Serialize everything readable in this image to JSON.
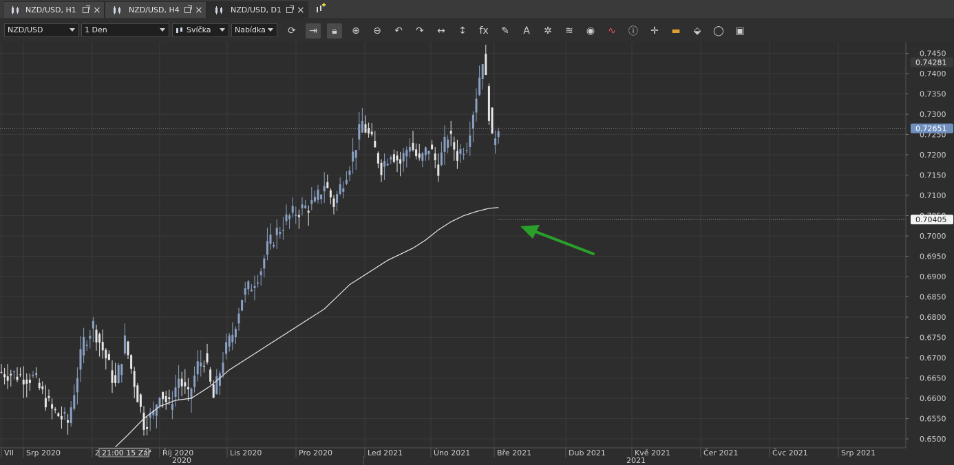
{
  "tabs": [
    {
      "label": "NZD/USD, H1"
    },
    {
      "label": "NZD/USD, H4"
    },
    {
      "label": "NZD/USD, D1"
    }
  ],
  "toolbar": {
    "symbol": "NZD/USD",
    "timeframe": "1 Den",
    "chart_type": "Svíčka",
    "price_side": "Nabídka"
  },
  "tool_icons": [
    "refresh-icon",
    "autoscroll-icon",
    "lock-icon",
    "zoom-in-icon",
    "zoom-out-icon",
    "undo-icon",
    "redo-icon",
    "horizontal-scale-icon",
    "vertical-scale-icon",
    "indicator-fx-icon",
    "pencil-icon",
    "text-tool-icon",
    "crosshair-network-icon",
    "layers-icon",
    "eye-icon",
    "oscillator-icon",
    "info-icon",
    "cursor-cross-icon",
    "color-bar-icon",
    "paint-bucket-icon",
    "circle-icon",
    "save-icon"
  ],
  "chart_data": {
    "type": "candlestick",
    "ylim": [
      0.6478,
      0.7478
    ],
    "y_ticks": [
      0.745,
      0.74,
      0.735,
      0.73,
      0.725,
      0.72,
      0.715,
      0.71,
      0.705,
      0.7,
      0.695,
      0.69,
      0.685,
      0.68,
      0.675,
      0.67,
      0.665,
      0.66,
      0.655,
      0.65
    ],
    "price_labels": {
      "high": "0.74281",
      "current": "0.72651",
      "ma": "0.70405"
    },
    "x_axis_labels": [
      "VII",
      "Srp 2020",
      "Zá",
      "Říj 2020",
      "Lis 2020",
      "Pro 2020",
      "Led 2021",
      "Úno 2021",
      "Bře 2021",
      "Dub 2021",
      "Kvě 2021",
      "Čer 2021",
      "Čvc 2021",
      "Srp 2021"
    ],
    "x_axis_years": [
      "2020",
      "2021"
    ],
    "crosshair_time": "21:00 15 Zář",
    "colors": {
      "bull": "#8aa1c4",
      "bear": "#e6e6e6",
      "ma": "#e8e8e8",
      "arrow": "#2aa02a"
    },
    "series": [
      {
        "name": "Candles",
        "anchors": [
          [
            0,
            0.6665
          ],
          [
            10,
            0.665
          ],
          [
            16,
            0.657
          ],
          [
            21,
            0.654
          ],
          [
            26,
            0.674
          ],
          [
            29,
            0.678
          ],
          [
            33,
            0.67
          ],
          [
            36,
            0.663
          ],
          [
            39,
            0.674
          ],
          [
            42,
            0.664
          ],
          [
            45,
            0.654
          ],
          [
            48,
            0.656
          ],
          [
            50,
            0.662
          ],
          [
            53,
            0.658
          ],
          [
            56,
            0.665
          ],
          [
            59,
            0.66
          ],
          [
            62,
            0.668
          ],
          [
            64,
            0.67
          ],
          [
            67,
            0.66
          ],
          [
            70,
            0.67
          ],
          [
            73,
            0.676
          ],
          [
            76,
            0.685
          ],
          [
            79,
            0.688
          ],
          [
            82,
            0.692
          ],
          [
            84,
            0.697
          ],
          [
            87,
            0.701
          ],
          [
            90,
            0.704
          ],
          [
            93,
            0.706
          ],
          [
            96,
            0.707
          ],
          [
            99,
            0.708
          ],
          [
            102,
            0.713
          ],
          [
            105,
            0.708
          ],
          [
            108,
            0.714
          ],
          [
            111,
            0.72
          ],
          [
            114,
            0.728
          ],
          [
            117,
            0.723
          ],
          [
            120,
            0.717
          ],
          [
            123,
            0.721
          ],
          [
            126,
            0.718
          ],
          [
            129,
            0.723
          ],
          [
            132,
            0.718
          ],
          [
            135,
            0.722
          ],
          [
            138,
            0.717
          ],
          [
            141,
            0.725
          ],
          [
            144,
            0.72
          ],
          [
            147,
            0.723
          ],
          [
            150,
            0.735
          ],
          [
            152,
            0.744
          ],
          [
            153,
            0.738
          ],
          [
            155,
            0.723
          ],
          [
            157,
            0.7275
          ]
        ]
      },
      {
        "name": "MA",
        "anchors": [
          [
            36,
            0.648
          ],
          [
            40,
            0.651
          ],
          [
            45,
            0.655
          ],
          [
            50,
            0.658
          ],
          [
            55,
            0.6595
          ],
          [
            60,
            0.66
          ],
          [
            66,
            0.663
          ],
          [
            72,
            0.667
          ],
          [
            78,
            0.67
          ],
          [
            84,
            0.673
          ],
          [
            90,
            0.676
          ],
          [
            96,
            0.679
          ],
          [
            102,
            0.682
          ],
          [
            106,
            0.685
          ],
          [
            110,
            0.688
          ],
          [
            114,
            0.69
          ],
          [
            118,
            0.692
          ],
          [
            122,
            0.694
          ],
          [
            126,
            0.6955
          ],
          [
            130,
            0.697
          ],
          [
            134,
            0.699
          ],
          [
            138,
            0.7015
          ],
          [
            142,
            0.7035
          ],
          [
            146,
            0.705
          ],
          [
            150,
            0.706
          ],
          [
            154,
            0.7068
          ],
          [
            157,
            0.707
          ]
        ]
      }
    ]
  }
}
